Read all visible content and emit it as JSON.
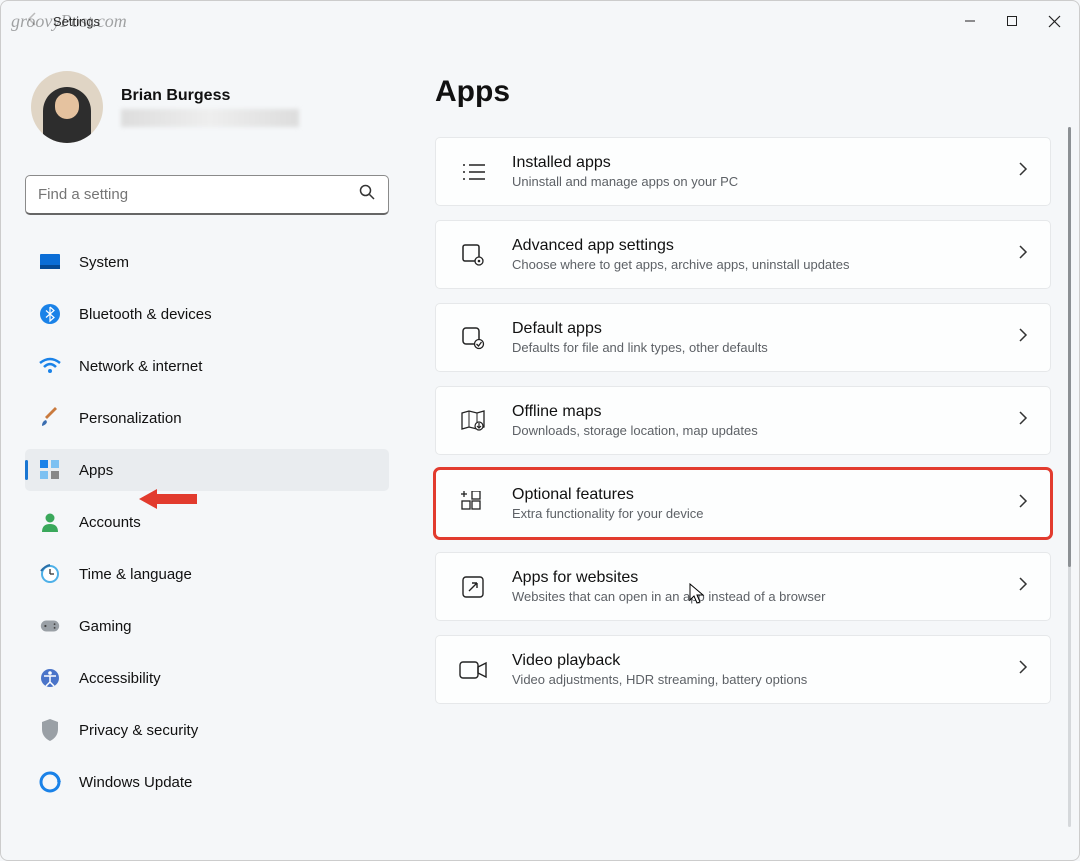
{
  "watermark": "groovyPost.com",
  "window": {
    "title": "Settings"
  },
  "profile": {
    "name": "Brian Burgess"
  },
  "search": {
    "placeholder": "Find a setting"
  },
  "nav": {
    "items": [
      {
        "label": "System"
      },
      {
        "label": "Bluetooth & devices"
      },
      {
        "label": "Network & internet"
      },
      {
        "label": "Personalization"
      },
      {
        "label": "Apps"
      },
      {
        "label": "Accounts"
      },
      {
        "label": "Time & language"
      },
      {
        "label": "Gaming"
      },
      {
        "label": "Accessibility"
      },
      {
        "label": "Privacy & security"
      },
      {
        "label": "Windows Update"
      }
    ]
  },
  "page": {
    "title": "Apps"
  },
  "cards": [
    {
      "title": "Installed apps",
      "sub": "Uninstall and manage apps on your PC"
    },
    {
      "title": "Advanced app settings",
      "sub": "Choose where to get apps, archive apps, uninstall updates"
    },
    {
      "title": "Default apps",
      "sub": "Defaults for file and link types, other defaults"
    },
    {
      "title": "Offline maps",
      "sub": "Downloads, storage location, map updates"
    },
    {
      "title": "Optional features",
      "sub": "Extra functionality for your device"
    },
    {
      "title": "Apps for websites",
      "sub": "Websites that can open in an app instead of a browser"
    },
    {
      "title": "Video playback",
      "sub": "Video adjustments, HDR streaming, battery options"
    }
  ]
}
